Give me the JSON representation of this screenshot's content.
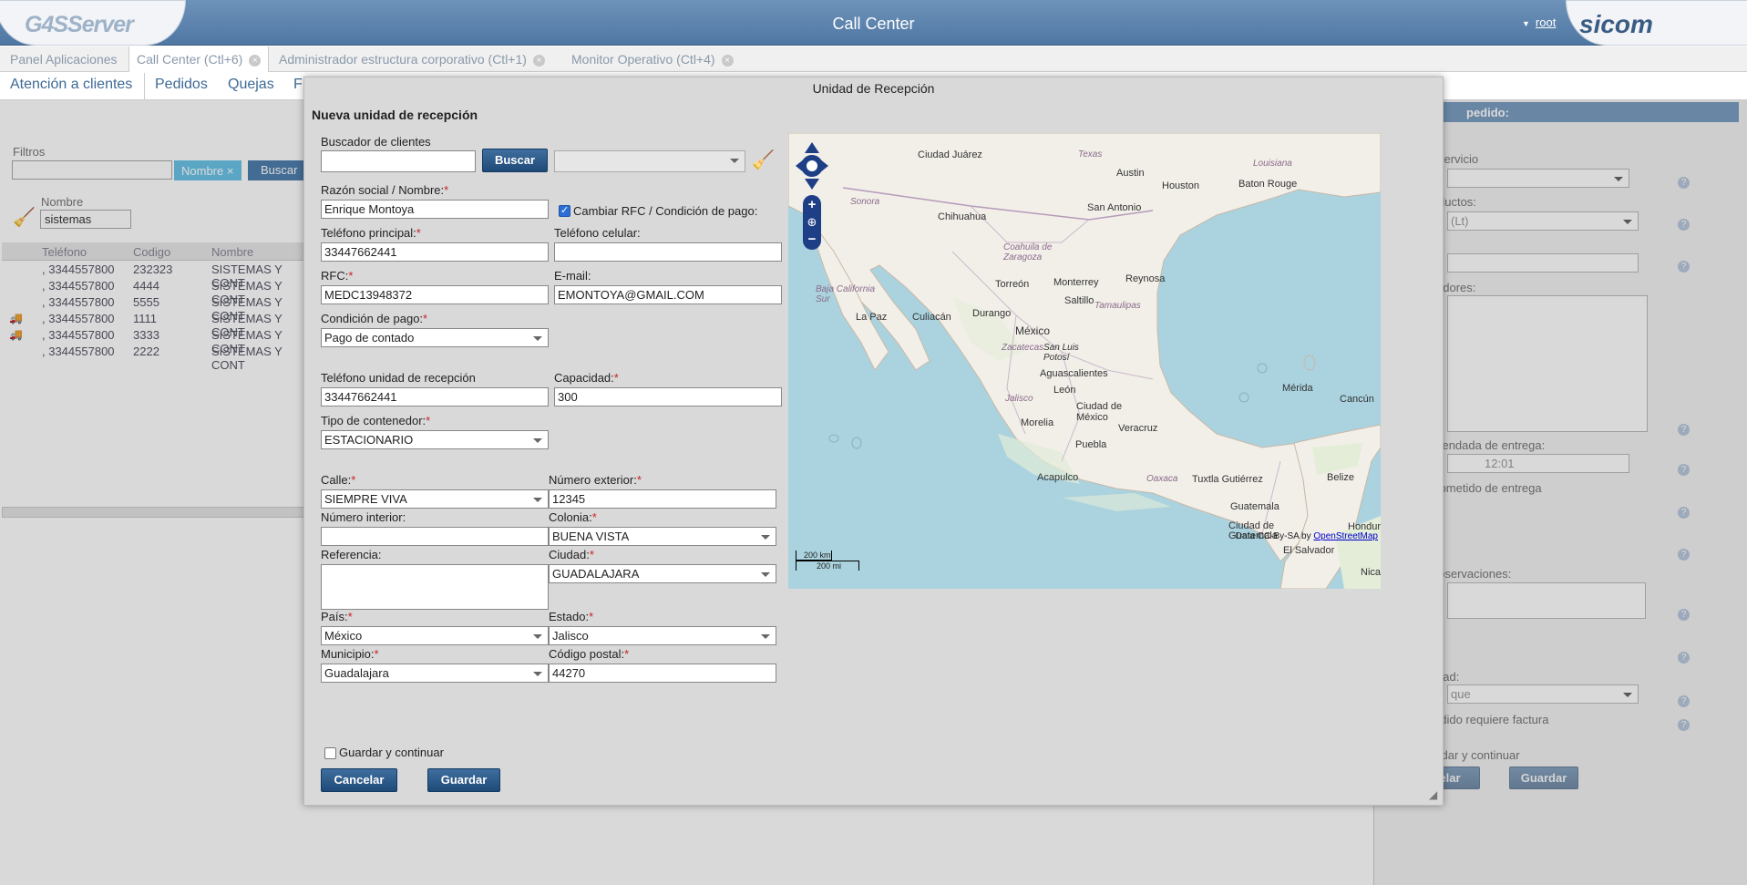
{
  "header": {
    "logo_left": "G4SServer",
    "title": "Call Center",
    "user": "root",
    "logo_right": "sicom"
  },
  "app_tabs": [
    {
      "label": "Panel Aplicaciones"
    },
    {
      "label": "Call Center (Ctl+6)"
    },
    {
      "label": "Administrador estructura corporativo (Ctl+1)"
    },
    {
      "label": "Monitor Operativo (Ctl+4)"
    }
  ],
  "sub_tabs": [
    {
      "label": "Atención a clientes"
    },
    {
      "label": "Pedidos"
    },
    {
      "label": "Quejas"
    },
    {
      "label": "F"
    }
  ],
  "left": {
    "filters_label": "Filtros",
    "filter_tag": "Nombre ×",
    "search_button": "Buscar",
    "name_label": "Nombre",
    "name_value": "sistemas",
    "columns": [
      "Teléfono",
      "Codigo",
      "Nombre"
    ],
    "rows": [
      {
        "tel": ", 3344557800",
        "code": "232323",
        "name": "SISTEMAS Y CONT"
      },
      {
        "tel": ", 3344557800",
        "code": "4444",
        "name": "SISTEMAS Y CONT"
      },
      {
        "tel": ", 3344557800",
        "code": "5555",
        "name": "SISTEMAS Y CONT"
      },
      {
        "tel": ", 3344557800",
        "code": "1111",
        "name": "SISTEMAS Y CONT"
      },
      {
        "tel": ", 3344557800",
        "code": "3333",
        "name": "SISTEMAS Y CONT"
      },
      {
        "tel": ", 3344557800",
        "code": "2222",
        "name": "SISTEMAS Y CONT"
      }
    ]
  },
  "right": {
    "title": "pedido:",
    "servicio": "servicio",
    "producto": "ductos:",
    "producto_val": "(Lt)",
    "ores": "adores:",
    "fecha": "agendada de entrega:",
    "hora": "12:01",
    "tiempo": "prometido de entrega",
    "obs": "Observaciones:",
    "unidad": "dad:",
    "unidad_val": "que",
    "factura": "edido requiere factura",
    "guardar_cont": "ardar y continuar",
    "cancelar": "elar",
    "guardar": "Guardar"
  },
  "dialog": {
    "title": "Unidad de Recepción",
    "subtitle": "Nueva unidad de recepción",
    "buscador_label": "Buscador de clientes",
    "buscar_button": "Buscar",
    "razon_label": "Razón social / Nombre:",
    "razon_value": "Enrique Montoya",
    "cambiar_rfc_label": "Cambiar RFC / Condición de pago:",
    "tel_principal_label": "Teléfono principal:",
    "tel_principal_value": "33447662441",
    "tel_celular_label": "Teléfono celular:",
    "rfc_label": "RFC:",
    "rfc_value": "MEDC13948372",
    "email_label": "E-mail:",
    "email_value": "EMONTOYA@GMAIL.COM",
    "condicion_label": "Condición de pago:",
    "condicion_value": "Pago de contado",
    "tel_unidad_label": "Teléfono unidad de recepción",
    "tel_unidad_value": "33447662441",
    "capacidad_label": "Capacidad:",
    "capacidad_value": "300",
    "contenedor_label": "Tipo de contenedor:",
    "contenedor_value": "ESTACIONARIO",
    "calle_label": "Calle:",
    "calle_value": "SIEMPRE VIVA",
    "num_ext_label": "Número exterior:",
    "num_ext_value": "12345",
    "num_int_label": "Número interior:",
    "colonia_label": "Colonia:",
    "colonia_value": "BUENA VISTA",
    "referencia_label": "Referencia:",
    "ciudad_label": "Ciudad:",
    "ciudad_value": "GUADALAJARA",
    "pais_label": "País:",
    "pais_value": "México",
    "estado_label": "Estado:",
    "estado_value": "Jalisco",
    "municipio_label": "Municipio:",
    "municipio_value": "Guadalajara",
    "cp_label": "Código postal:",
    "cp_value": "44270",
    "guardar_continuar_label": "Guardar y continuar",
    "cancelar_button": "Cancelar",
    "guardar_button": "Guardar"
  },
  "map": {
    "attribution": "Data CC-By-SA by",
    "attribution_link": "OpenStreetMap",
    "scale_km": "200 km",
    "scale_mi": "200 mi",
    "cities": [
      "Ciudad Juárez",
      "Austin",
      "Houston",
      "Baton Rouge",
      "San Antonio",
      "Chihuahua",
      "Torreón",
      "Monterrey",
      "Reynosa",
      "Saltillo",
      "La Paz",
      "Culiacán",
      "Durango",
      "México",
      "San Luis Potosí",
      "Aguascalientes",
      "León",
      "Mérida",
      "Cancún",
      "Ciudad de México",
      "Morelia",
      "Veracruz",
      "Puebla",
      "Acapulco",
      "Oaxaca",
      "Tuxtla Gutiérrez",
      "Belize",
      "Guatemala",
      "Ciudad de Guatemala",
      "Hondur",
      "El Salvador",
      "Nica",
      "Zacatecas",
      "Jalisco"
    ],
    "regions": [
      "Texas",
      "Louisiana",
      "Sonora",
      "Coahuila de Zaragoza",
      "Baja California Sur",
      "Tamaulipas"
    ]
  }
}
